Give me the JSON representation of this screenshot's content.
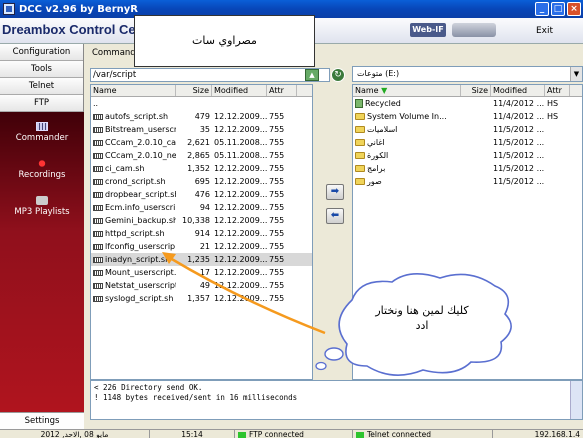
{
  "window": {
    "title": "DCC v2.96 by BernyR",
    "brand": "Dreambox Control Cen",
    "webif": "Web-IF",
    "exit": "Exit"
  },
  "sidebar": {
    "items": [
      "Configuration",
      "Tools",
      "Telnet",
      "FTP"
    ],
    "modules": [
      "Commander",
      "Recordings",
      "MP3 Playlists"
    ],
    "settings": "Settings"
  },
  "main": {
    "title": "Commander",
    "path": "/var/script",
    "drive": "متوعات (E:)",
    "left_headers": [
      "Name",
      "Size",
      "Modified",
      "Attr"
    ],
    "right_headers": [
      "Name",
      "Size",
      "Modified",
      "Attr"
    ],
    "left_rows": [
      {
        "name": "..",
        "size": "",
        "mod": "",
        "attr": ""
      },
      {
        "name": "autofs_script.sh",
        "size": "479",
        "mod": "12.12.2009...",
        "attr": "755"
      },
      {
        "name": "Bitstream_userscr...",
        "size": "35",
        "mod": "12.12.2009...",
        "attr": "755"
      },
      {
        "name": "CCcam_2.0.10_ca...",
        "size": "2,621",
        "mod": "05.11.2008...",
        "attr": "755"
      },
      {
        "name": "CCcam_2.0.10_ne...",
        "size": "2,865",
        "mod": "05.11.2008...",
        "attr": "755"
      },
      {
        "name": "ci_cam.sh",
        "size": "1,352",
        "mod": "12.12.2009...",
        "attr": "755"
      },
      {
        "name": "crond_script.sh",
        "size": "695",
        "mod": "12.12.2009...",
        "attr": "755"
      },
      {
        "name": "dropbear_script.sh",
        "size": "476",
        "mod": "12.12.2009...",
        "attr": "755"
      },
      {
        "name": "Ecm.info_userscri...",
        "size": "94",
        "mod": "12.12.2009...",
        "attr": "755"
      },
      {
        "name": "Gemini_backup.sh",
        "size": "10,338",
        "mod": "12.12.2009...",
        "attr": "755"
      },
      {
        "name": "httpd_script.sh",
        "size": "914",
        "mod": "12.12.2009...",
        "attr": "755"
      },
      {
        "name": "lfconfig_userscrip...",
        "size": "21",
        "mod": "12.12.2009...",
        "attr": "755"
      },
      {
        "name": "inadyn_script.sh",
        "size": "1,235",
        "mod": "12.12.2009...",
        "attr": "755"
      },
      {
        "name": "Mount_userscript...",
        "size": "17",
        "mod": "12.12.2009...",
        "attr": "755"
      },
      {
        "name": "Netstat_userscript...",
        "size": "49",
        "mod": "12.12.2009...",
        "attr": "755"
      },
      {
        "name": "syslogd_script.sh",
        "size": "1,357",
        "mod": "12.12.2009...",
        "attr": "755"
      }
    ],
    "right_rows": [
      {
        "name": "Recycled",
        "size": "",
        "mod": "11/4/2012 ...",
        "attr": "HS"
      },
      {
        "name": "System Volume In...",
        "size": "",
        "mod": "11/4/2012 ...",
        "attr": "HS"
      },
      {
        "name": "اسلاميات",
        "size": "",
        "mod": "11/5/2012 ...",
        "attr": ""
      },
      {
        "name": "اغاني",
        "size": "",
        "mod": "11/5/2012 ...",
        "attr": ""
      },
      {
        "name": "الكورة",
        "size": "",
        "mod": "11/5/2012 ...",
        "attr": ""
      },
      {
        "name": "برامج",
        "size": "",
        "mod": "11/5/2012 ...",
        "attr": ""
      },
      {
        "name": "صور",
        "size": "",
        "mod": "11/5/2012 ...",
        "attr": ""
      }
    ],
    "log": [
      "< 226 Directory send OK.",
      "! 1148 bytes received/sent in 16 milliseconds"
    ]
  },
  "statusbar": {
    "date": "2012 ,مايو 08 ,الاحد",
    "time": "15:14",
    "ftp": "FTP connected",
    "telnet": "Telnet connected",
    "ip": "192.168.1.4"
  },
  "overlays": {
    "label_box": "مصراوي سات",
    "bubble_line1": "كليك لمين هنا ونختار",
    "bubble_line2": "ادد"
  }
}
